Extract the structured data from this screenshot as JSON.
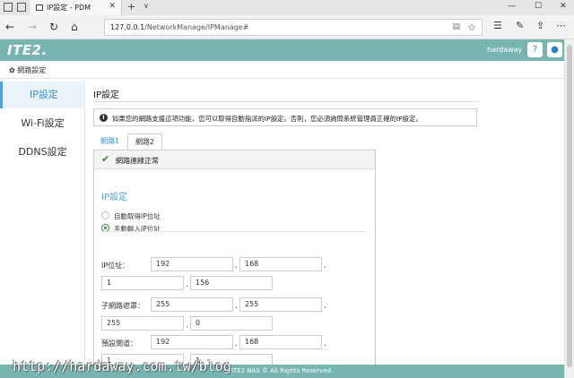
{
  "browser": {
    "tab_title": "IP設定 - PDM",
    "tab_close": "✕",
    "new_tab": "+",
    "tab_more": "∨",
    "url_host": "127.0.0.1",
    "url_path": "/NetworkManage/IPManage#",
    "minimize": "—",
    "maximize": "☐",
    "close": "✕"
  },
  "header": {
    "logo": "ITE2.",
    "username": "hardaway"
  },
  "breadcrumb": "網路設定",
  "sidebar": {
    "items": [
      {
        "label": "IP設定"
      },
      {
        "label": "Wi-Fi設定"
      },
      {
        "label": "DDNS設定"
      }
    ]
  },
  "main": {
    "title": "IP設定",
    "alert": "如果您的網路支援這項功能，您可以取得自動指派的IP設定。否則，您必須詢問系統管理員正確的IP設定。",
    "tabs": [
      {
        "label": "網路1"
      },
      {
        "label": "網路2"
      }
    ],
    "status": "網路連線正常",
    "section_title": "IP設定",
    "radio_auto": "自動取得IP位址",
    "radio_manual": "手動輸入IP位址",
    "ip_label": "IP位址：",
    "ip": [
      "192",
      "168",
      "1",
      "156"
    ],
    "mask_label": "子網路遮罩：",
    "mask": [
      "255",
      "255",
      "255",
      "0"
    ],
    "gateway_label": "預設閘道：",
    "gateway": [
      "192",
      "168",
      "1",
      "1"
    ]
  },
  "footer": "ITE2 NAS © All Rights Reserved.",
  "watermark": "http://hardaway.com.tw/blog",
  "colors": {
    "header": "#76b5b0",
    "accent": "#4aa3df",
    "ok": "#2e8b3a"
  }
}
